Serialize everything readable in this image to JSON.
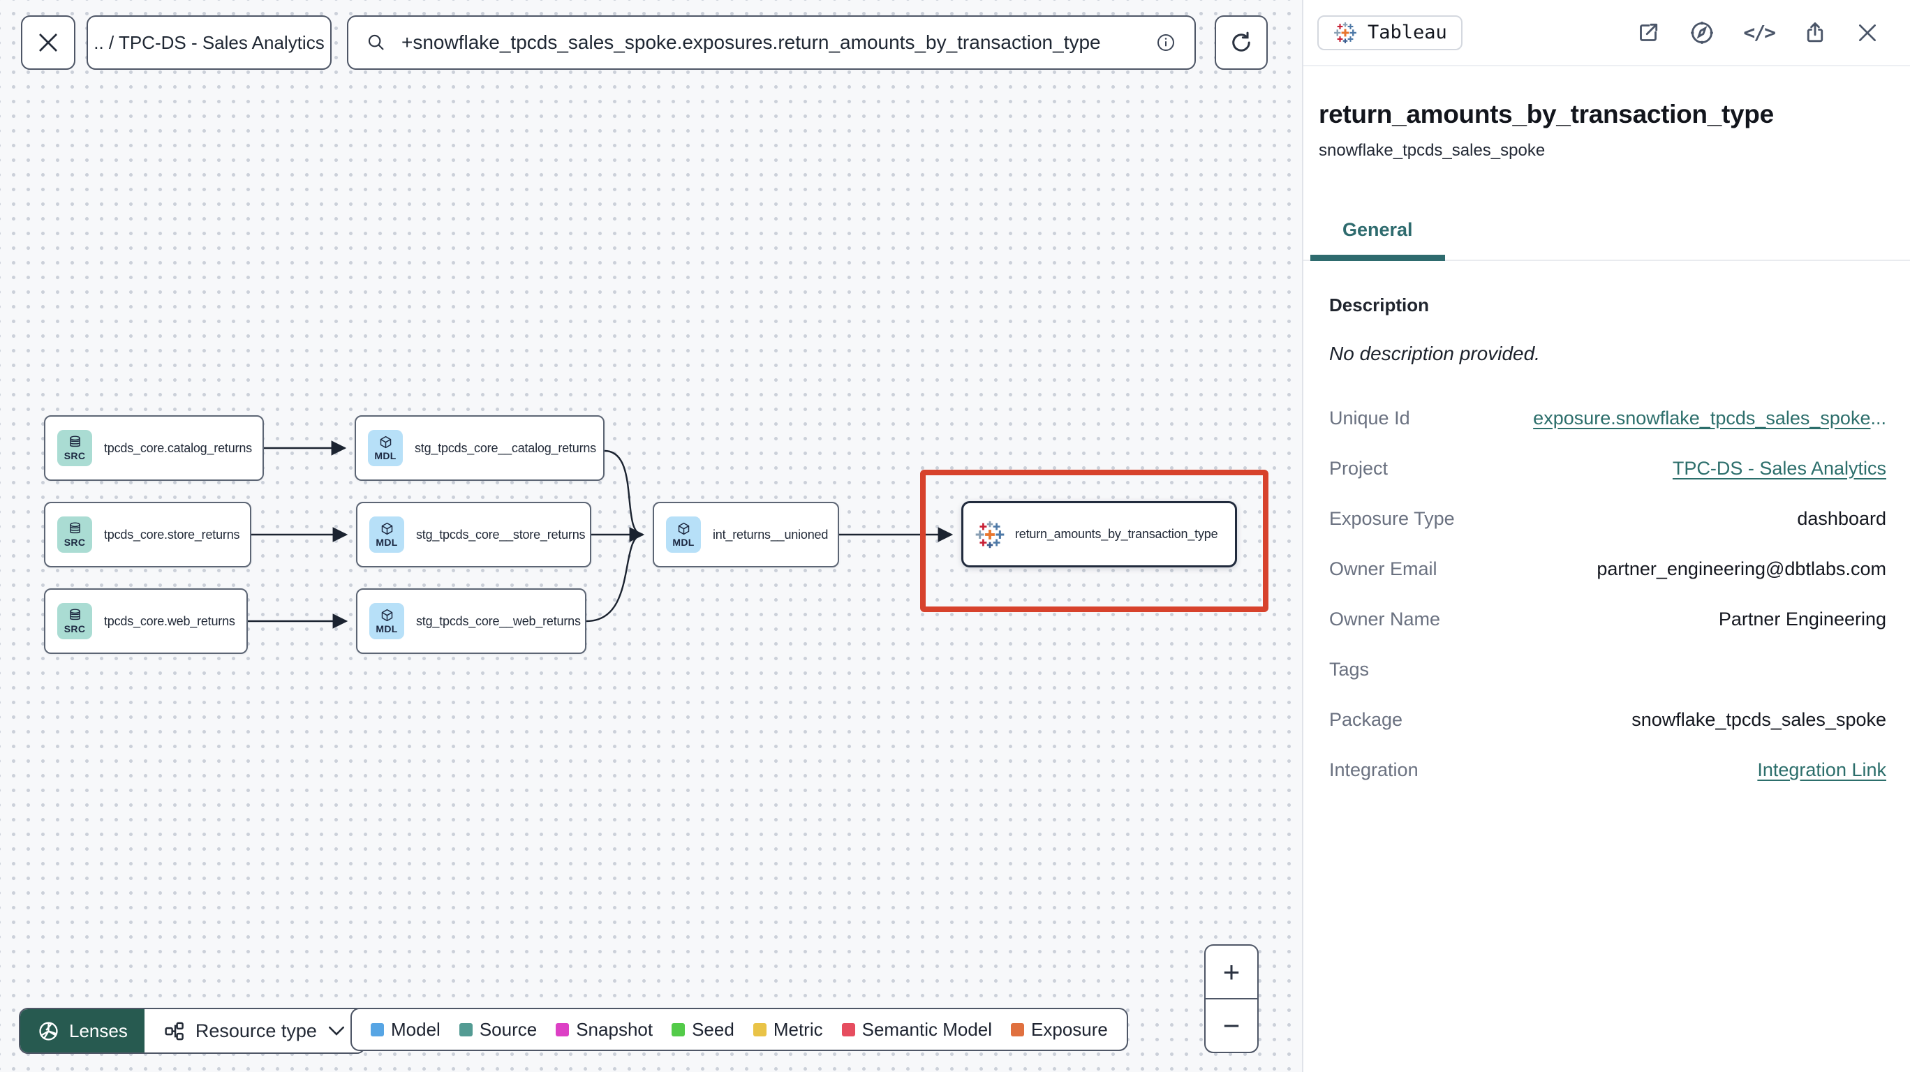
{
  "header": {
    "breadcrumb": ".. / TPC-DS - Sales Analytics",
    "search_value": "+snowflake_tpcds_sales_spoke.exposures.return_amounts_by_transaction_type"
  },
  "canvas": {
    "nodes": [
      {
        "badge": "SRC",
        "label": "tpcds_core.catalog_returns"
      },
      {
        "badge": "MDL",
        "label": "stg_tpcds_core__catalog_returns"
      },
      {
        "badge": "SRC",
        "label": "tpcds_core.store_returns"
      },
      {
        "badge": "MDL",
        "label": "stg_tpcds_core__store_returns"
      },
      {
        "badge": "MDL",
        "label": "int_returns__unioned"
      },
      {
        "badge": "SRC",
        "label": "tpcds_core.web_returns"
      },
      {
        "badge": "MDL",
        "label": "stg_tpcds_core__web_returns"
      },
      {
        "badge": "tableau",
        "label": "return_amounts_by_transaction_type"
      }
    ],
    "highlight_color": "#d7422c",
    "toolbar": {
      "lenses": "Lenses",
      "resource_type": "Resource type"
    },
    "legend": [
      {
        "label": "Model",
        "color": "#57a5e4"
      },
      {
        "label": "Source",
        "color": "#539b93"
      },
      {
        "label": "Snapshot",
        "color": "#dd40c5"
      },
      {
        "label": "Seed",
        "color": "#53cb49"
      },
      {
        "label": "Metric",
        "color": "#e9c347"
      },
      {
        "label": "Semantic Model",
        "color": "#e64d5f"
      },
      {
        "label": "Exposure",
        "color": "#e0703f"
      }
    ],
    "zoom": {
      "in": "+",
      "out": "−"
    }
  },
  "panel": {
    "badge": "Tableau",
    "title": "return_amounts_by_transaction_type",
    "subtitle": "snowflake_tpcds_sales_spoke",
    "accent_teal": "#2e6b6e",
    "tabs": [
      {
        "label": "General"
      }
    ],
    "description_label": "Description",
    "description": "No description provided.",
    "fields": [
      {
        "label": "Unique Id",
        "value": "exposure.snowflake_tpcds_sales_spoke",
        "suffix": "..."
      },
      {
        "label": "Project",
        "value": "TPC-DS - Sales Analytics"
      },
      {
        "label": "Exposure Type",
        "value": "dashboard"
      },
      {
        "label": "Owner Email",
        "value": "partner_engineering@dbtlabs.com"
      },
      {
        "label": "Owner Name",
        "value": "Partner Engineering"
      },
      {
        "label": "Tags",
        "value": ""
      },
      {
        "label": "Package",
        "value": "snowflake_tpcds_sales_spoke"
      },
      {
        "label": "Integration",
        "value": "Integration Link"
      }
    ]
  }
}
